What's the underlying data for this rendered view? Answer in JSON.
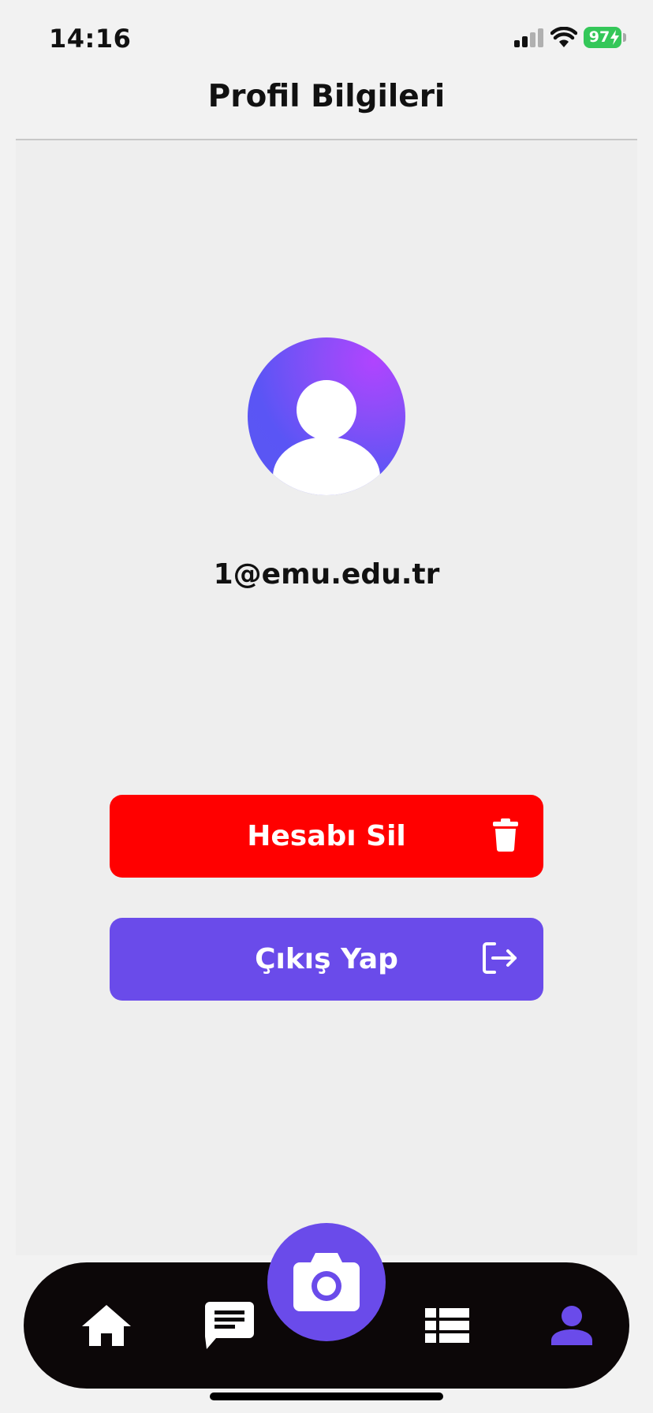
{
  "status_bar": {
    "time": "14:16",
    "battery": "97"
  },
  "header": {
    "title": "Profil Bilgileri"
  },
  "profile": {
    "email": "1@emu.edu.tr"
  },
  "actions": {
    "delete_label": "Hesabı Sil",
    "logout_label": "Çıkış Yap"
  },
  "colors": {
    "delete": "#ff0000",
    "accent": "#6a4bea",
    "nav_background": "#0c0708",
    "battery": "#34c759"
  },
  "nav": {
    "items": [
      {
        "icon": "home-icon",
        "active": false
      },
      {
        "icon": "chat-icon",
        "active": false
      },
      {
        "icon": "camera-icon",
        "active": false,
        "center": true
      },
      {
        "icon": "list-icon",
        "active": false
      },
      {
        "icon": "person-icon",
        "active": true
      }
    ]
  }
}
